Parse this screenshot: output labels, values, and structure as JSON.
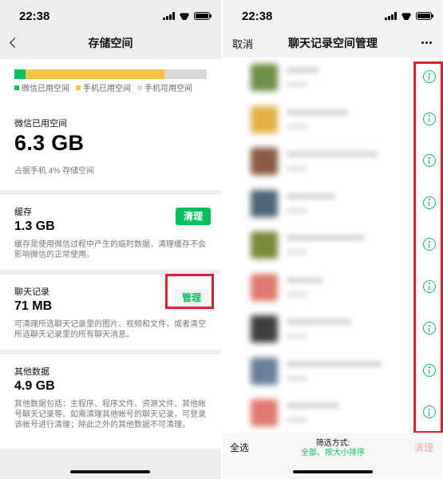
{
  "left": {
    "status_time": "22:38",
    "nav_title": "存储空间",
    "storage": {
      "wechat_fraction": 0.06,
      "phone_fraction": 0.72,
      "legend": [
        {
          "label": "微信已用空间",
          "color": "#07c160"
        },
        {
          "label": "手机已用空间",
          "color": "#f5c242"
        },
        {
          "label": "手机可用空间",
          "color": "#d8d8d8"
        }
      ],
      "used_label": "微信已用空间",
      "used_value": "6.3 GB",
      "used_note": "占据手机 4% 存储空间"
    },
    "cache": {
      "title": "缓存",
      "value": "1.3 GB",
      "desc": "缓存是使用微信过程中产生的临时数据，清理缓存不会影响微信的正常使用。",
      "button": "清理"
    },
    "chat": {
      "title": "聊天记录",
      "value": "71 MB",
      "desc": "可清理所选聊天记录里的图片、视频和文件，或者清空所选聊天记录里的所有聊天消息。",
      "button": "管理"
    },
    "other": {
      "title": "其他数据",
      "value": "4.9 GB",
      "desc": "其他数据包括：主程序、程序文件、资源文件、其他帐号聊天记录等。如需清理其他帐号的聊天记录，可登录该帐号进行清理；除此之外的其他数据不可清理。"
    }
  },
  "right": {
    "status_time": "22:38",
    "nav_cancel": "取消",
    "nav_title": "聊天记录空间管理",
    "chat_rows": [
      {
        "avatar_color": "#6f8f4a"
      },
      {
        "avatar_color": "#e2b245"
      },
      {
        "avatar_color": "#8a5a44"
      },
      {
        "avatar_color": "#4f6678"
      },
      {
        "avatar_color": "#7a8a3a"
      },
      {
        "avatar_color": "#e07a70"
      },
      {
        "avatar_color": "#3f3f3f"
      },
      {
        "avatar_color": "#6a7f9a"
      },
      {
        "avatar_color": "#e07a70"
      }
    ],
    "bottom": {
      "select_all": "全选",
      "filter_title": "筛选方式:",
      "filter_value": "全部、按大小排序",
      "clear": "清理"
    }
  }
}
